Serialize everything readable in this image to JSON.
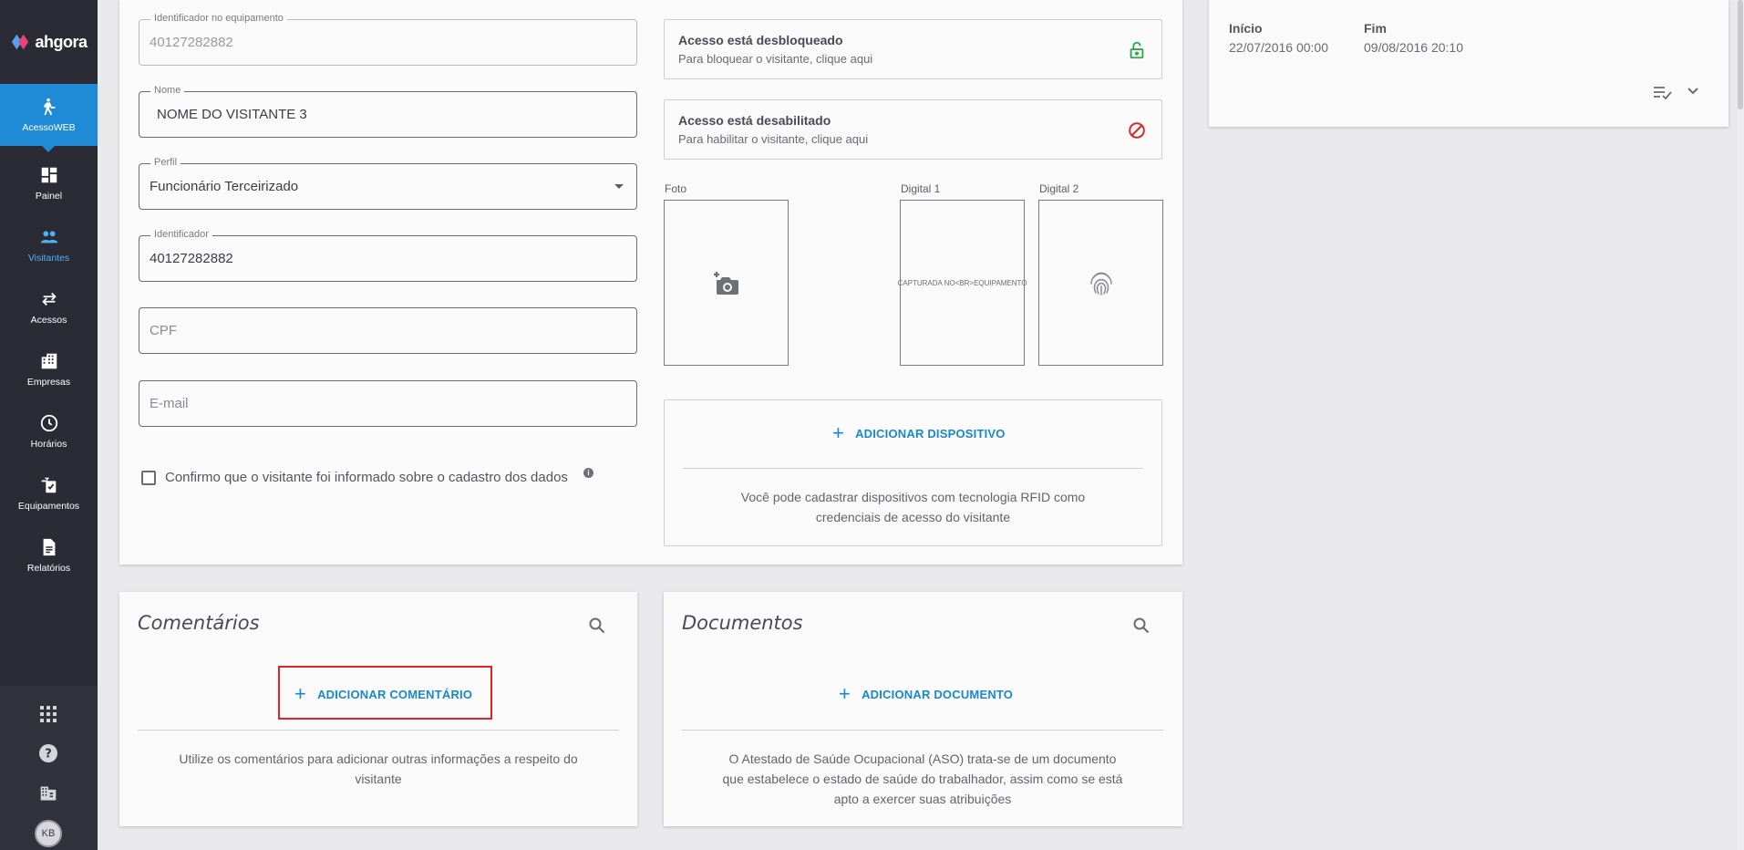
{
  "app": {
    "logo_text": "ahgora",
    "module_label": "AcessoWEB"
  },
  "sidebar": {
    "items": [
      {
        "label": "Painel",
        "icon": "dashboard-icon"
      },
      {
        "label": "Visitantes",
        "icon": "people-icon"
      },
      {
        "label": "Acessos",
        "icon": "swap-arrows-icon"
      },
      {
        "label": "Empresas",
        "icon": "building-icon"
      },
      {
        "label": "Horários",
        "icon": "clock-icon"
      },
      {
        "label": "Equipamentos",
        "icon": "device-icon"
      },
      {
        "label": "Relatórios",
        "icon": "report-icon"
      }
    ],
    "selected": "Visitantes",
    "bottom": {
      "apps_icon": "apps-grid-icon",
      "help_icon": "help-icon",
      "company_icon": "company-icon",
      "avatar_initials": "KB"
    },
    "accent_color": "#1f8bd6"
  },
  "form": {
    "equipment_id": {
      "label": "Identificador no equipamento",
      "value": "40127282882"
    },
    "name": {
      "label": "Nome",
      "value": "NOME DO VISITANTE 3"
    },
    "profile": {
      "label": "Perfil",
      "value": "Funcionário Terceirizado"
    },
    "identifier": {
      "label": "Identificador",
      "value": "40127282882"
    },
    "cpf": {
      "placeholder": "CPF"
    },
    "email": {
      "placeholder": "E-mail"
    },
    "consent": {
      "label": "Confirmo que o visitante foi informado sobre o cadastro dos dados",
      "checked": false
    }
  },
  "access": {
    "unlocked": {
      "title": "Acesso está desbloqueado",
      "subtitle": "Para bloquear o visitante, clique aqui",
      "icon": "lock-open-icon",
      "color": "#2aa84a"
    },
    "disabled": {
      "title": "Acesso está desabilitado",
      "subtitle": "Para habilitar o visitante, clique aqui",
      "icon": "block-icon",
      "color": "#d42b2b"
    }
  },
  "media": {
    "photo_label": "Foto",
    "digital1_label": "Digital 1",
    "digital1_text": "CAPTURADA NO<BR>EQUIPAMENTO",
    "digital2_label": "Digital 2"
  },
  "devices": {
    "add_label": "ADICIONAR DISPOSITIVO",
    "help": "Você pode cadastrar dispositivos com tecnologia RFID como credenciais de acesso do visitante"
  },
  "period": {
    "start_label": "Início",
    "start_value": "22/07/2016 00:00",
    "end_label": "Fim",
    "end_value": "09/08/2016 20:10"
  },
  "comments": {
    "title": "Comentários",
    "add_label": "ADICIONAR COMENTÁRIO",
    "help": "Utilize os comentários para adicionar outras informações a respeito do visitante"
  },
  "documents": {
    "title": "Documentos",
    "add_label": "ADICIONAR DOCUMENTO",
    "help": "O Atestado de Saúde Ocupacional (ASO) trata-se de um documento que estabelece o estado de saúde do trabalhador, assim como se está apto a exercer suas atribuições"
  }
}
